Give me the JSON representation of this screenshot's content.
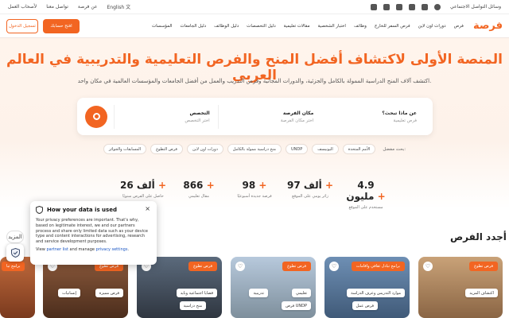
{
  "topbar": {
    "lang": "English",
    "links": [
      "عن فرصة",
      "تواصل معنا",
      "لأصحاب العمل"
    ],
    "social_label": "وسائل التواصل الاجتماعي"
  },
  "nav": {
    "login": "تسجيل الدخول",
    "signup": "افتح حسابك",
    "menu": [
      "فرص",
      "دورات اون لاين",
      "فرص السفر للخارج",
      "وظائف",
      "اختبار الشخصية",
      "مقالات تعليمية",
      "دليل التخصصات",
      "دليل الوظائف",
      "دليل الجامعات",
      "المؤسسات"
    ],
    "logo": "فرصة"
  },
  "hero": {
    "title": "المنصة الأولى لاكتشاف أفضل المنح والفرص التعليمية والتدريبية في العالم العربي",
    "subtitle": "اكتشف آلاف المنح الدراسية الممولة بالكامل والجزئية، والدورات المجانية وفرص التدريب والعمل من أفضل الجامعات والمؤسسات العالمية في مكان واحد."
  },
  "search": {
    "f1_label": "عن ماذا تبحث؟",
    "f1_ph": "فرص تعليمية",
    "f2_label": "مكان الفرصة",
    "f2_ph": "اختر مكان الفرصة",
    "f3_label": "التخصص",
    "f3_ph": "اختر التخصص"
  },
  "chips": {
    "lead": "بحث مفضل:",
    "items": [
      "الأمم المتحدة",
      "اليونيسف",
      "UNDP",
      "منح دراسية ممولة بالكامل",
      "دورات اون لاين",
      "فرص التطوع",
      "المسابقات والجوائز"
    ]
  },
  "stats": [
    {
      "num": "4.9 مليون",
      "cap": "مستخدم على الموقع"
    },
    {
      "num": "97 ألف",
      "cap": "زائر يومي على الموقع"
    },
    {
      "num": "98",
      "cap": "فرصة جديدة أسبوعيًا"
    },
    {
      "num": "866",
      "cap": "مقال تعليمي"
    },
    {
      "num": "26 ألف",
      "cap": "حاصل على الفرص سنويًا"
    }
  ],
  "latest": {
    "title": "أجدد الفرص",
    "more": "المزيد"
  },
  "cards": [
    {
      "tag": "فرص تطوع",
      "chips": [
        "اكتشاف المزيد"
      ]
    },
    {
      "tag": "برامج تبادل ثقافي واقامات",
      "chips": [
        "موارد التدريس وعرف الدراسة",
        "فرص عمل"
      ]
    },
    {
      "tag": "فرص تطوع",
      "chips": [
        "تعليمي",
        "تدريبية",
        "فرص UNDP"
      ]
    },
    {
      "tag": "فرص تطوع",
      "chips": [
        "قضايا اجتماعية وبايد",
        "منح دراسية"
      ]
    },
    {
      "tag": "فرص تطوع",
      "chips": [
        "فرص مميزة",
        "إنسانيات"
      ]
    },
    {
      "tag": "برامج تبا",
      "chips": []
    }
  ],
  "consent": {
    "title": "How your data is used",
    "body": "Your privacy preferences are important. That's why, based on legitimate interest, we and our partners process and share only limited data such as your device type and content interactions for advertising, research and service development purposes.",
    "link_pre": "View ",
    "link1": "partner list",
    "mid": " and manage ",
    "link2": "privacy settings",
    "end": "."
  }
}
